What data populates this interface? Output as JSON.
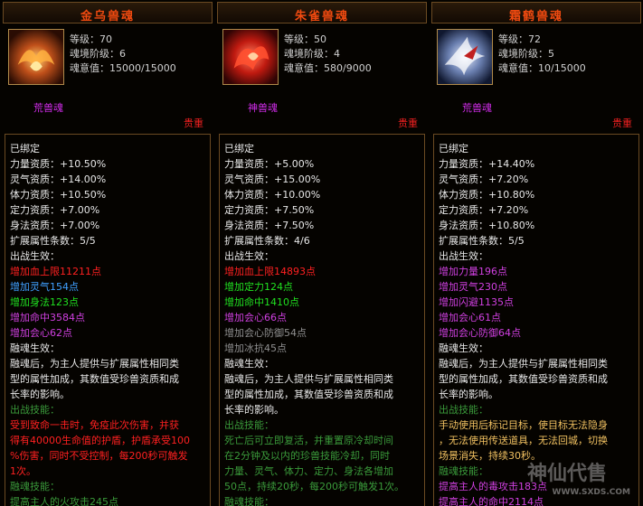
{
  "panels": [
    {
      "title": "金乌兽魂",
      "stats": [
        "等级：70",
        "魂境阶级：6",
        "魂意值：15000/15000"
      ],
      "soul_type": "荒兽魂",
      "rarity": "贵重",
      "lines": [
        {
          "text": "已绑定",
          "c": "w"
        },
        {
          "text": "力量资质：+10.50%",
          "c": "w"
        },
        {
          "text": "灵气资质：+14.00%",
          "c": "w"
        },
        {
          "text": "体力资质：+10.50%",
          "c": "w"
        },
        {
          "text": "定力资质：+7.00%",
          "c": "w"
        },
        {
          "text": "身法资质：+7.00%",
          "c": "w"
        },
        {
          "text": "扩展属性条数：5/5",
          "c": "w"
        },
        {
          "text": "出战生效：",
          "c": "w"
        },
        {
          "text": "增加血上限11211点",
          "c": "r"
        },
        {
          "text": "增加灵气154点",
          "c": "b"
        },
        {
          "text": "增加身法123点",
          "c": "g"
        },
        {
          "text": "增加命中3584点",
          "c": "p"
        },
        {
          "text": "增加会心62点",
          "c": "p"
        },
        {
          "text": "融魂生效：",
          "c": "w"
        },
        {
          "text": "融魂后，为主人提供与扩展属性相同类",
          "c": "w"
        },
        {
          "text": "型的属性加成，其数值受珍兽资质和成",
          "c": "w"
        },
        {
          "text": "长率的影响。",
          "c": "w"
        },
        {
          "text": "出战技能：",
          "c": "dg"
        },
        {
          "text": "受到致命一击时，免疫此次伤害，并获",
          "c": "r"
        },
        {
          "text": "得有40000生命值的护盾，护盾承受100",
          "c": "r"
        },
        {
          "text": "%伤害，同时不受控制，每200秒可触发",
          "c": "r"
        },
        {
          "text": "1次。",
          "c": "r"
        },
        {
          "text": "融魂技能：",
          "c": "dg"
        },
        {
          "text": "提高主人的火攻击245点",
          "c": "dg"
        }
      ]
    },
    {
      "title": "朱雀兽魂",
      "stats": [
        "等级：50",
        "魂境阶级：4",
        "魂意值：580/9000"
      ],
      "soul_type": "神兽魂",
      "rarity": "贵重",
      "lines": [
        {
          "text": "已绑定",
          "c": "w"
        },
        {
          "text": "力量资质：+5.00%",
          "c": "w"
        },
        {
          "text": "灵气资质：+15.00%",
          "c": "w"
        },
        {
          "text": "体力资质：+10.00%",
          "c": "w"
        },
        {
          "text": "定力资质：+7.50%",
          "c": "w"
        },
        {
          "text": "身法资质：+7.50%",
          "c": "w"
        },
        {
          "text": "扩展属性条数：4/6",
          "c": "w"
        },
        {
          "text": "出战生效：",
          "c": "w"
        },
        {
          "text": "增加血上限14893点",
          "c": "r"
        },
        {
          "text": "增加定力124点",
          "c": "g"
        },
        {
          "text": "增加命中1410点",
          "c": "g"
        },
        {
          "text": "增加会心66点",
          "c": "p"
        },
        {
          "text": "增加会心防御54点",
          "c": "gr"
        },
        {
          "text": "增加冰抗45点",
          "c": "gr"
        },
        {
          "text": "融魂生效：",
          "c": "w"
        },
        {
          "text": "融魂后，为主人提供与扩展属性相同类",
          "c": "w"
        },
        {
          "text": "型的属性加成，其数值受珍兽资质和成",
          "c": "w"
        },
        {
          "text": "长率的影响。",
          "c": "w"
        },
        {
          "text": "出战技能：",
          "c": "dg"
        },
        {
          "text": "死亡后可立即复活，并重置原冷却时间",
          "c": "dg"
        },
        {
          "text": "在2分钟及以内的珍兽技能冷却，同时",
          "c": "dg"
        },
        {
          "text": "力量、灵气、体力、定力、身法各增加",
          "c": "dg"
        },
        {
          "text": "50点，持续20秒，每200秒可触发1次。",
          "c": "dg"
        },
        {
          "text": "融魂技能：",
          "c": "dg"
        }
      ]
    },
    {
      "title": "霜鹤兽魂",
      "stats": [
        "等级：72",
        "魂境阶级：5",
        "魂意值：10/15000"
      ],
      "soul_type": "荒兽魂",
      "rarity": "贵重",
      "lines": [
        {
          "text": "已绑定",
          "c": "w"
        },
        {
          "text": "力量资质：+14.40%",
          "c": "w"
        },
        {
          "text": "灵气资质：+7.20%",
          "c": "w"
        },
        {
          "text": "体力资质：+10.80%",
          "c": "w"
        },
        {
          "text": "定力资质：+7.20%",
          "c": "w"
        },
        {
          "text": "身法资质：+10.80%",
          "c": "w"
        },
        {
          "text": "扩展属性条数：5/5",
          "c": "w"
        },
        {
          "text": "出战生效：",
          "c": "w"
        },
        {
          "text": "增加力量196点",
          "c": "p"
        },
        {
          "text": "增加灵气230点",
          "c": "p"
        },
        {
          "text": "增加闪避1135点",
          "c": "p"
        },
        {
          "text": "增加会心61点",
          "c": "p"
        },
        {
          "text": "增加会心防御64点",
          "c": "p"
        },
        {
          "text": "融魂生效：",
          "c": "w"
        },
        {
          "text": "融魂后，为主人提供与扩展属性相同类",
          "c": "w"
        },
        {
          "text": "型的属性加成，其数值受珍兽资质和成",
          "c": "w"
        },
        {
          "text": "长率的影响。",
          "c": "w"
        },
        {
          "text": "出战技能：",
          "c": "dg"
        },
        {
          "text": "手动使用后标记目标，使目标无法隐身",
          "c": "o"
        },
        {
          "text": "，无法使用传送道具，无法回城，切换",
          "c": "o"
        },
        {
          "text": "场景消失，持续30秒。",
          "c": "o"
        },
        {
          "text": "融魂技能：",
          "c": "dg"
        },
        {
          "text": "提高主人的毒攻击183点",
          "c": "p"
        },
        {
          "text": "提高主人的命中2114点",
          "c": "p"
        }
      ]
    }
  ],
  "watermark": {
    "text": "神仙代售",
    "url": "WWW.SXDS.COM"
  }
}
